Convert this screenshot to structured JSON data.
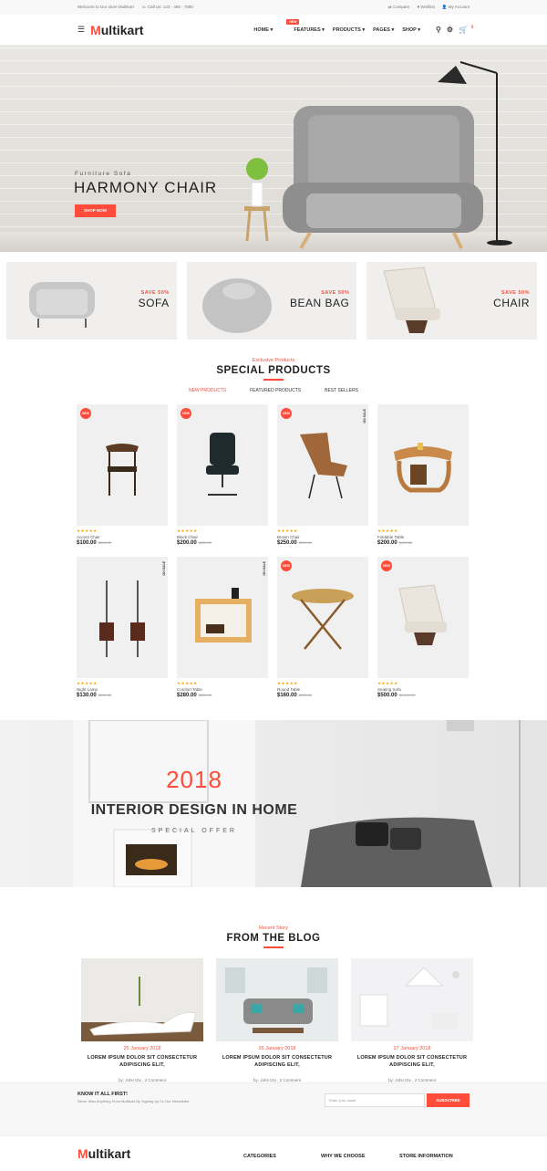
{
  "topbar": {
    "welcome": "Welcome to Our store Multikart",
    "phone": "Call Us: 123 - 456 - 7890",
    "compare": "Compare",
    "wishlist": "Wishlist",
    "account": "My Account"
  },
  "header": {
    "logo_first": "M",
    "logo_rest": "ultikart",
    "nav": [
      "HOME",
      "FEATURES",
      "PRODUCTS",
      "PAGES",
      "SHOP"
    ],
    "new_tag": "NEW",
    "cart_count": "0"
  },
  "hero": {
    "subtitle": "Furniture Sofa",
    "title": "HARMONY CHAIR",
    "button": "SHOP NOW"
  },
  "categories": [
    {
      "save": "SAVE 50%",
      "name": "SOFA"
    },
    {
      "save": "SAVE 50%",
      "name": "BEAN BAG"
    },
    {
      "save": "SAVE 50%",
      "name": "CHAIR"
    }
  ],
  "special": {
    "subtitle": "Exclusive Products",
    "title": "SPECIAL PRODUCTS",
    "tabs": [
      "NEW PRODUCTS",
      "FEATURED PRODUCTS",
      "BEST SELLERS"
    ]
  },
  "products": [
    {
      "name": "Accent Chair",
      "price": "$100.00",
      "old": "$260.00",
      "badge": "NEW",
      "sale": ""
    },
    {
      "name": "Black Chair",
      "price": "$200.00",
      "old": "$400.00",
      "badge": "NEW",
      "sale": ""
    },
    {
      "name": "Brown Chair",
      "price": "$250.00",
      "old": "$300.00",
      "badge": "NEW",
      "sale": "ON SALE"
    },
    {
      "name": "Foldable Table",
      "price": "$200.00",
      "old": "$400.00",
      "badge": "",
      "sale": ""
    },
    {
      "name": "Night Lamp",
      "price": "$130.00",
      "old": "$260.00",
      "badge": "",
      "sale": "ON SALE"
    },
    {
      "name": "Comfort Table",
      "price": "$280.00",
      "old": "$300.00",
      "badge": "",
      "sale": "ON SALE"
    },
    {
      "name": "Round Table",
      "price": "$160.00",
      "old": "$300.00",
      "badge": "NEW",
      "sale": ""
    },
    {
      "name": "Seating Sofa",
      "price": "$500.00",
      "old": "$1,000.00",
      "badge": "NEW",
      "sale": ""
    }
  ],
  "stars": "★★★★★",
  "banner": {
    "year": "2018",
    "title": "INTERIOR DESIGN IN HOME",
    "subtitle": "SPECIAL OFFER"
  },
  "blog": {
    "subtitle": "Recent Story",
    "title": "FROM THE BLOG",
    "posts": [
      {
        "date": "25 January 2018",
        "title": "LOREM IPSUM DOLOR SIT CONSECTETUR ADIPISCING ELIT,",
        "by": "by: John Dio , 2 Comment"
      },
      {
        "date": "26 January 2018",
        "title": "LOREM IPSUM DOLOR SIT CONSECTETUR ADIPISCING ELIT,",
        "by": "by: John Dio , 2 Comment"
      },
      {
        "date": "27 January 2018",
        "title": "LOREM IPSUM DOLOR SIT CONSECTETUR ADIPISCING ELIT,",
        "by": "by: John Dio , 2 Comment"
      }
    ]
  },
  "newsletter": {
    "heading": "KNOW IT ALL FIRST!",
    "sub": "Never Miss Anything From Multikart By Signing Up To Our Newsletter.",
    "placeholder": "Enter your email",
    "button": "SUBSCRIBE"
  },
  "footer": {
    "logo_first": "M",
    "logo_rest": "ultikart",
    "cols": [
      "CATEGORIES",
      "WHY WE CHOOSE",
      "STORE INFORMATION"
    ]
  },
  "colors": {
    "accent": "#ff4c3b"
  }
}
